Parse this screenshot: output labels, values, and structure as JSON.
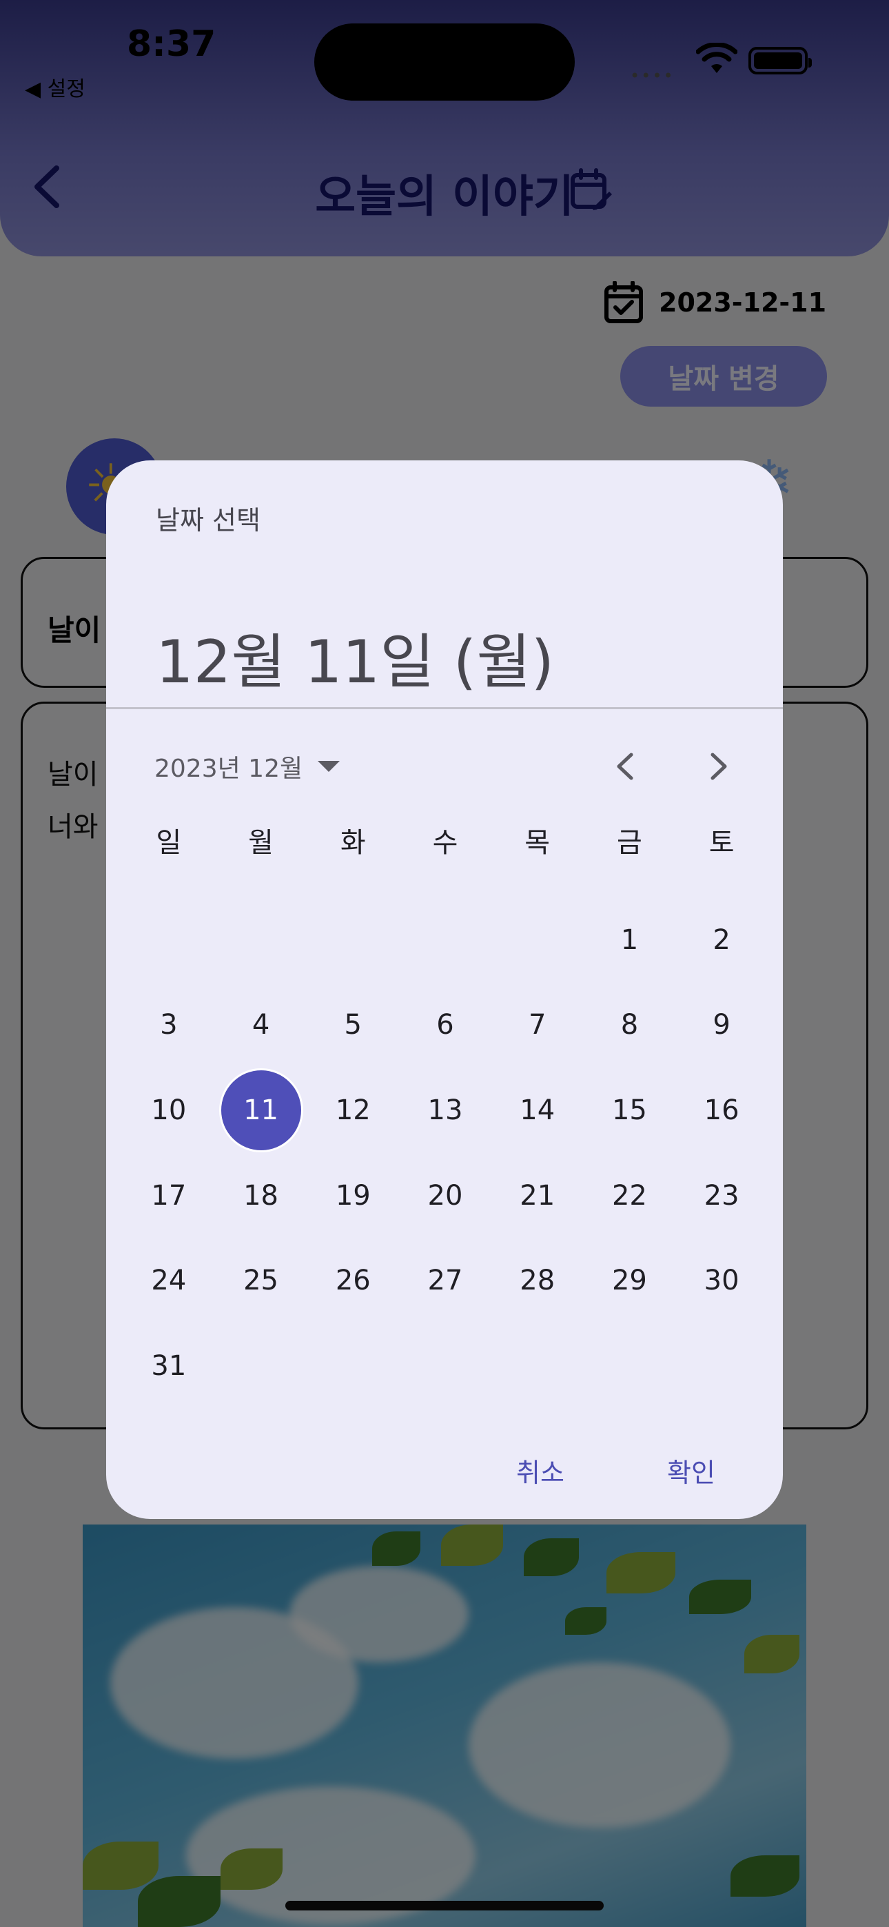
{
  "status_bar": {
    "time": "8:37",
    "back_app": "◀ 설정"
  },
  "header": {
    "title": "오늘의 이야기",
    "back_icon": "chevron-left-icon",
    "title_icon": "calendar-edit-icon",
    "gradient_top": "#3a3b8c",
    "gradient_bottom": "#8f91d9"
  },
  "entry": {
    "date": "2023-12-11",
    "change_date_label": "날짜 변경",
    "weather_selected": "sun-icon",
    "weather_other": "snowflake-icon",
    "card1_text": "날이",
    "card2_lines": [
      "날이",
      "너와"
    ]
  },
  "date_picker": {
    "label": "날짜 선택",
    "selected_display": "12월 11일 (월)",
    "month_label": "2023년 12월",
    "weekdays": [
      "일",
      "월",
      "화",
      "수",
      "목",
      "금",
      "토"
    ],
    "leading_blanks": 5,
    "days_in_month": 31,
    "selected_day": 11,
    "accent_color": "#4f4fb8",
    "cancel_label": "취소",
    "ok_label": "확인"
  }
}
